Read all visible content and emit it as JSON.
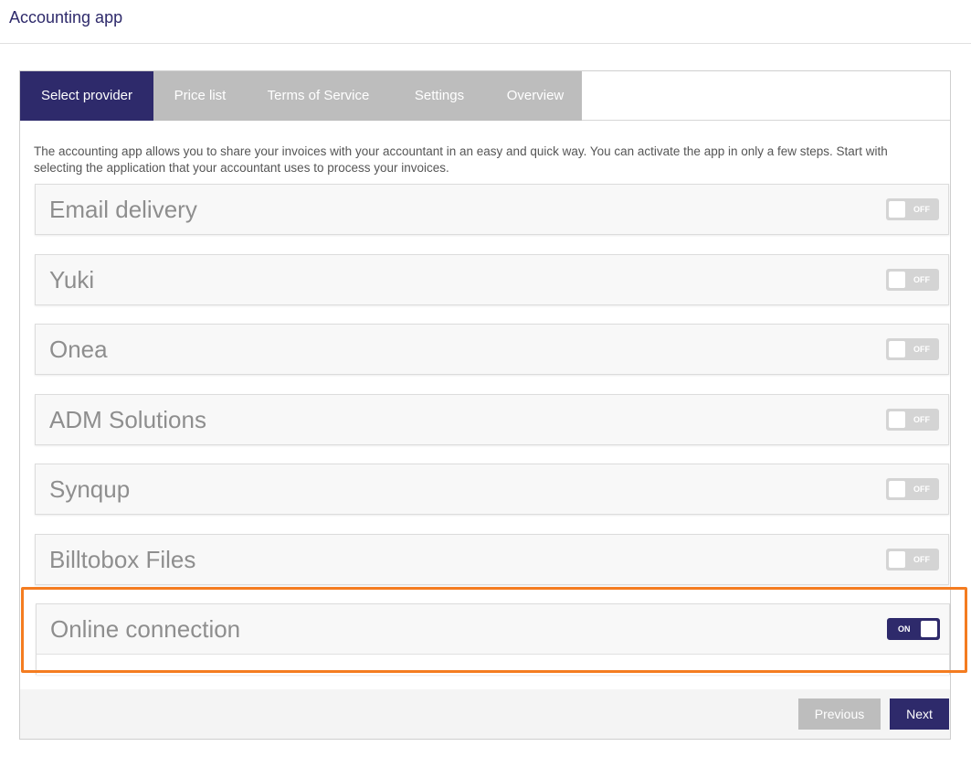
{
  "header": {
    "title": "Accounting app"
  },
  "tabs": [
    {
      "label": "Select provider",
      "active": true
    },
    {
      "label": "Price list",
      "active": false
    },
    {
      "label": "Terms of Service",
      "active": false
    },
    {
      "label": "Settings",
      "active": false
    },
    {
      "label": "Overview",
      "active": false
    }
  ],
  "intro": "The accounting app allows you to share your invoices with your accountant in an easy and quick way. You can activate the app in only a few steps. Start with selecting the application that your accountant uses to process your invoices.",
  "providers": [
    {
      "name": "Email delivery",
      "toggle": "OFF"
    },
    {
      "name": "Yuki",
      "toggle": "OFF"
    },
    {
      "name": "Onea",
      "toggle": "OFF"
    },
    {
      "name": "ADM Solutions",
      "toggle": "OFF"
    },
    {
      "name": "Synqup",
      "toggle": "OFF"
    },
    {
      "name": "Billtobox Files",
      "toggle": "OFF"
    },
    {
      "name": "Online connection",
      "toggle": "ON"
    }
  ],
  "footer": {
    "previous_label": "Previous",
    "next_label": "Next"
  },
  "colors": {
    "brand": "#2e2a6b",
    "inactive": "#bdbdbd",
    "highlight": "#f47c20"
  }
}
